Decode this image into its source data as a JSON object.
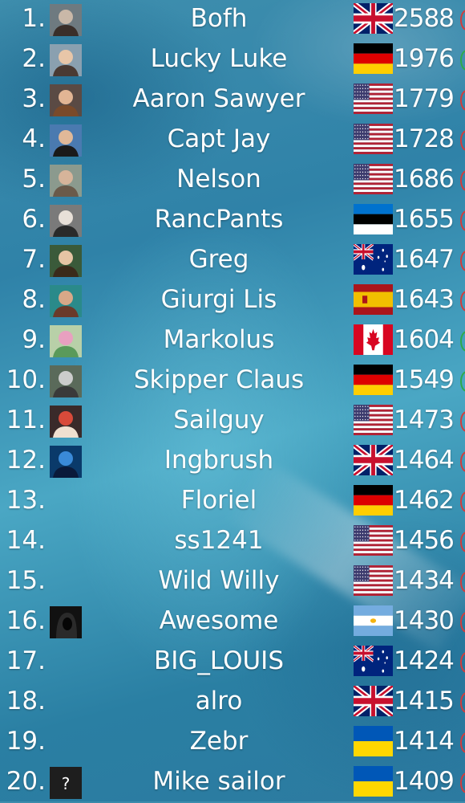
{
  "leaderboard": {
    "rows": [
      {
        "rank": "1.",
        "name": "Bofh",
        "flag": "uk-flag-icon",
        "score": "2588",
        "trend": "#d33b3b",
        "avatar": "avatar-photo-icon"
      },
      {
        "rank": "2.",
        "name": "Lucky Luke",
        "flag": "germany-flag-icon",
        "score": "1976",
        "trend": "#2faa4a",
        "avatar": "avatar-photo-icon"
      },
      {
        "rank": "3.",
        "name": "Aaron Sawyer",
        "flag": "usa-flag-icon",
        "score": "1779",
        "trend": "#d33b3b",
        "avatar": "avatar-photo-icon"
      },
      {
        "rank": "4.",
        "name": "Capt Jay",
        "flag": "usa-flag-icon",
        "score": "1728",
        "trend": "#d33b3b",
        "avatar": "avatar-photo-icon"
      },
      {
        "rank": "5.",
        "name": "Nelson",
        "flag": "usa-flag-icon",
        "score": "1686",
        "trend": "#d33b3b",
        "avatar": "avatar-photo-icon"
      },
      {
        "rank": "6.",
        "name": "RancPants",
        "flag": "estonia-flag-icon",
        "score": "1655",
        "trend": "#d33b3b",
        "avatar": "avatar-photo-icon"
      },
      {
        "rank": "7.",
        "name": "Greg",
        "flag": "australia-flag-icon",
        "score": "1647",
        "trend": "#d33b3b",
        "avatar": "avatar-photo-icon"
      },
      {
        "rank": "8.",
        "name": "Giurgi Lis",
        "flag": "spain-flag-icon",
        "score": "1643",
        "trend": "#d33b3b",
        "avatar": "avatar-photo-icon"
      },
      {
        "rank": "9.",
        "name": "Markolus",
        "flag": "canada-flag-icon",
        "score": "1604",
        "trend": "#2faa4a",
        "avatar": "avatar-photo-icon"
      },
      {
        "rank": "10.",
        "name": "Skipper Claus",
        "flag": "germany-flag-icon",
        "score": "1549",
        "trend": "#2faa4a",
        "avatar": "avatar-photo-icon"
      },
      {
        "rank": "11.",
        "name": "Sailguy",
        "flag": "usa-flag-icon",
        "score": "1473",
        "trend": "#d33b3b",
        "avatar": "avatar-photo-icon"
      },
      {
        "rank": "12.",
        "name": "Ingbrush",
        "flag": "uk-flag-icon",
        "score": "1464",
        "trend": "#d33b3b",
        "avatar": "avatar-photo-icon"
      },
      {
        "rank": "13.",
        "name": "Floriel",
        "flag": "germany-flag-icon",
        "score": "1462",
        "trend": "#d33b3b",
        "avatar": ""
      },
      {
        "rank": "14.",
        "name": "ss1241",
        "flag": "usa-flag-icon",
        "score": "1456",
        "trend": "#d33b3b",
        "avatar": ""
      },
      {
        "rank": "15.",
        "name": "Wild Willy",
        "flag": "usa-flag-icon",
        "score": "1434",
        "trend": "#d33b3b",
        "avatar": ""
      },
      {
        "rank": "16.",
        "name": "Awesome",
        "flag": "argentina-flag-icon",
        "score": "1430",
        "trend": "#d33b3b",
        "avatar": "hooded-figure-icon"
      },
      {
        "rank": "17.",
        "name": "BIG_LOUIS",
        "flag": "australia-flag-icon",
        "score": "1424",
        "trend": "#d33b3b",
        "avatar": ""
      },
      {
        "rank": "18.",
        "name": "alro",
        "flag": "uk-flag-icon",
        "score": "1415",
        "trend": "#d33b3b",
        "avatar": ""
      },
      {
        "rank": "19.",
        "name": "Zebr",
        "flag": "ukraine-flag-icon",
        "score": "1414",
        "trend": "#d33b3b",
        "avatar": ""
      },
      {
        "rank": "20.",
        "name": "Mike sailor",
        "flag": "ukraine-flag-icon",
        "score": "1409",
        "trend": "#d33b3b",
        "avatar": "question-mark-icon"
      }
    ]
  }
}
